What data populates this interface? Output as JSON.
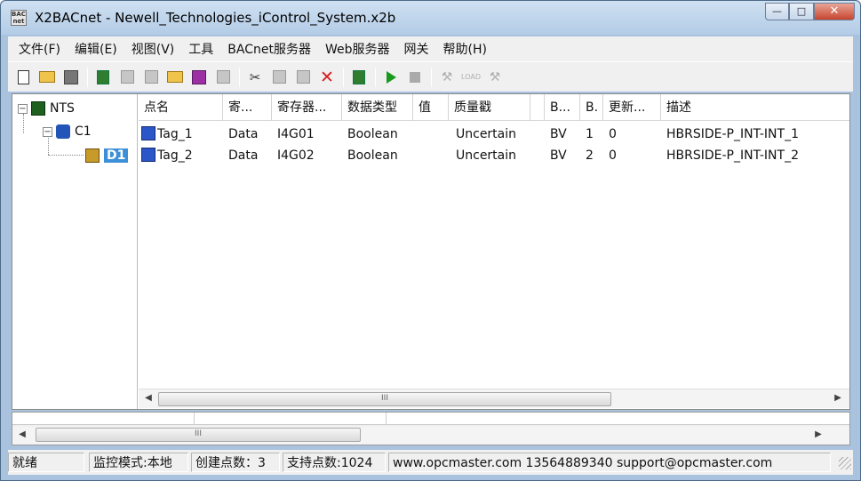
{
  "window": {
    "app_icon_text": "BAC net",
    "title": "X2BACnet - Newell_Technologies_iControl_System.x2b",
    "controls": {
      "minimize": "—",
      "maximize": "□",
      "close": "✕"
    }
  },
  "menubar": {
    "items": [
      {
        "label": "文件(F)"
      },
      {
        "label": "编辑(E)"
      },
      {
        "label": "视图(V)"
      },
      {
        "label": "工具"
      },
      {
        "label": "BACnet服务器"
      },
      {
        "label": "Web服务器"
      },
      {
        "label": "网关"
      },
      {
        "label": "帮助(H)"
      }
    ]
  },
  "toolbar": {
    "cut_glyph": "✂",
    "delete_glyph": "✕",
    "faded_glyphs": [
      "⚒",
      "LOAD",
      "⚒"
    ]
  },
  "tree": {
    "nodes": [
      {
        "label": "NTS",
        "expander": "−"
      },
      {
        "label": "C1",
        "expander": "−"
      },
      {
        "label": "D1"
      }
    ]
  },
  "table": {
    "columns": [
      "点名",
      "寄...",
      "寄存器...",
      "数据类型",
      "值",
      "质量戳",
      "",
      "B...",
      "B.",
      "更新...",
      "描述"
    ],
    "rows": [
      {
        "name": "Tag_1",
        "type": "Data",
        "register": "I4G01",
        "datatype": "Boolean",
        "value": "",
        "quality": "Uncertain",
        "extra": "",
        "b1": "BV",
        "b2": "1",
        "update": "0",
        "desc": "HBRSIDE-P_INT-INT_1"
      },
      {
        "name": "Tag_2",
        "type": "Data",
        "register": "I4G02",
        "datatype": "Boolean",
        "value": "",
        "quality": "Uncertain",
        "extra": "",
        "b1": "BV",
        "b2": "2",
        "update": "0",
        "desc": "HBRSIDE-P_INT-INT_2"
      }
    ],
    "scroll": {
      "left": "◀",
      "right": "▶",
      "thumb": "III"
    }
  },
  "lower": {
    "scroll": {
      "left": "◀",
      "right": "▶",
      "thumb": "III"
    }
  },
  "statusbar": {
    "ready": "就绪",
    "mode": "监控模式:本地",
    "created": "创建点数：3",
    "supported": "支持点数:1024",
    "contact": "www.opcmaster.com 13564889340 support@opcmaster.com"
  }
}
